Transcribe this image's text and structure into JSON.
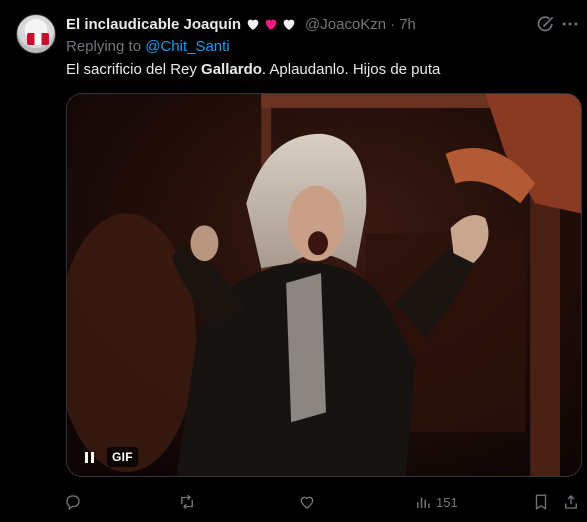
{
  "author": {
    "display_name": "El inclaudicable Joaquín",
    "handle": "@JoacoKzn",
    "separator": "·",
    "time": "7h",
    "hearts": [
      "white-heart",
      "red-heart",
      "white-heart"
    ]
  },
  "reply": {
    "prefix": "Replying to",
    "to_handle": "@Chit_Santi"
  },
  "tweet_text": {
    "before": "El sacrificio del Rey ",
    "bold": "Gallardo",
    "after": ". Aplaudanlo. Hijos de puta"
  },
  "media": {
    "badge": "GIF",
    "state": "playing"
  },
  "actions": {
    "views_count": "151"
  },
  "colors": {
    "background": "#000000",
    "text_primary": "#e7e9ea",
    "text_secondary": "#71767b",
    "link": "#1d9bf0",
    "heart_red": "#f91880"
  }
}
